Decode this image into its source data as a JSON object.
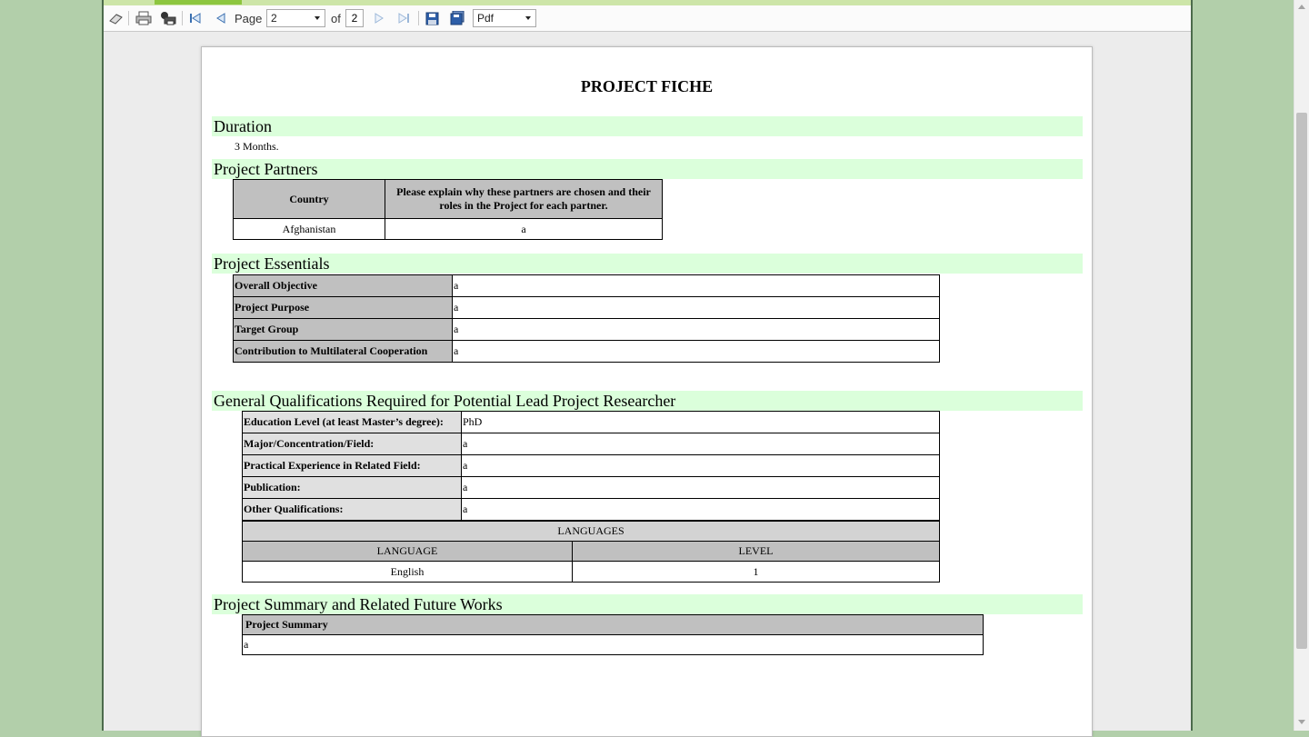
{
  "toolbar": {
    "page_label": "Page",
    "current_page": "2",
    "of_label": "of",
    "total_pages": "2",
    "export_format": "Pdf"
  },
  "document": {
    "title": "PROJECT FICHE",
    "duration": {
      "heading": "Duration",
      "value": "3 Months."
    },
    "partners": {
      "heading": "Project Partners",
      "columns": [
        "Country",
        "Please explain why these partners are chosen and their roles in the Project for each partner."
      ],
      "rows": [
        {
          "country": "Afghanistan",
          "role": "a"
        }
      ]
    },
    "essentials": {
      "heading": "Project Essentials",
      "rows": [
        {
          "label": "Overall Objective",
          "value": "a"
        },
        {
          "label": "Project Purpose",
          "value": "a"
        },
        {
          "label": "Target Group",
          "value": "a"
        },
        {
          "label": "Contribution to Multilateral Cooperation",
          "value": "a"
        }
      ]
    },
    "qualifications": {
      "heading": "General Qualifications Required for Potential Lead Project Researcher",
      "rows": [
        {
          "label": "Education Level (at least Master’s degree):",
          "value": "PhD"
        },
        {
          "label": "Major/Concentration/Field:",
          "value": "a"
        },
        {
          "label": "Practical Experience in Related Field:",
          "value": "a"
        },
        {
          "label": "Publication:",
          "value": "a"
        },
        {
          "label": "Other Qualifications:",
          "value": "a"
        }
      ],
      "languages_heading": "LANGUAGES",
      "language_col": "LANGUAGE",
      "level_col": "LEVEL",
      "languages": [
        {
          "language": "English",
          "level": "1"
        }
      ]
    },
    "summary": {
      "heading": "Project Summary and Related Future Works",
      "label": "Project Summary",
      "value": "a"
    }
  }
}
